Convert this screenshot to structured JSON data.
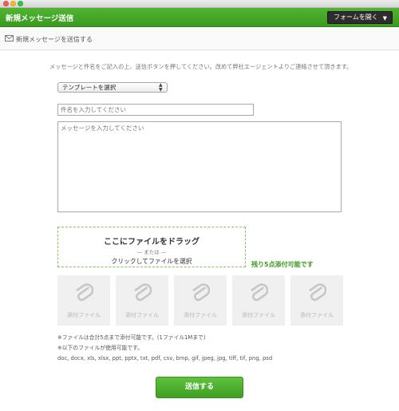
{
  "window": {
    "buttons": [
      "close",
      "minimize",
      "maximize"
    ]
  },
  "appbar": {
    "title": "新規メッセージ送信",
    "form_button_label": "フォームを開く",
    "form_button_caret": "▼",
    "accent_color": "#3a9a20"
  },
  "subheader": {
    "icon": "mail-send-icon",
    "label": "新規メッセージを送信する"
  },
  "intro_text": "メッセージと件名をご記入の上、送信ボタンを押してください。改めて弊社エージェントよりご連絡させて頂きます。",
  "template_select": {
    "selected": "テンプレートを選択"
  },
  "subject_input": {
    "value": "",
    "placeholder": "件名を入力してください"
  },
  "message_input": {
    "value": "",
    "placeholder": "メッセージを入力してください"
  },
  "dropzone": {
    "main": "ここにファイルをドラッグ",
    "or": "― または ―",
    "click": "クリックしてファイルを選択"
  },
  "remaining_label": "残り5点添付可能です",
  "attachments": {
    "slot_icon": "paperclip-icon",
    "slots": [
      {
        "label": "添付ファイル"
      },
      {
        "label": "添付ファイル"
      },
      {
        "label": "添付ファイル"
      },
      {
        "label": "添付ファイル"
      },
      {
        "label": "添付ファイル"
      }
    ]
  },
  "notes": {
    "limit": "※ファイルは合計5点まで添付可能です。(1ファイル1Mまで)",
    "types_heading": "※以下のファイルが使用可能です。",
    "types": "doc, docx, xls, xlsx, ppt, pptx, txt, pdf, csv, bmp, gif, jpeg, jpg, tiff, tif, png, psd"
  },
  "submit_label": "送信する"
}
